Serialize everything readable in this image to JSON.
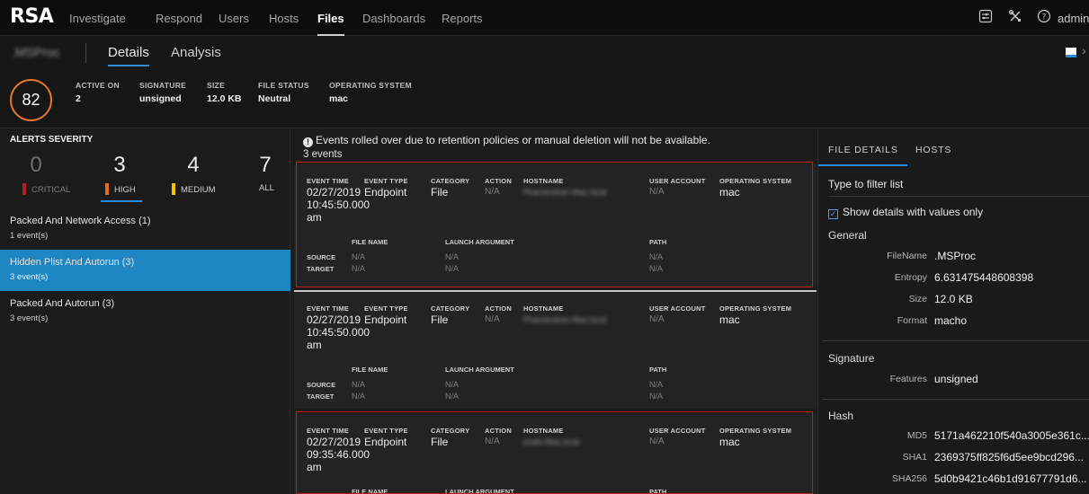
{
  "topnav": {
    "logo": "RSA",
    "items": [
      "Investigate",
      "Respond",
      "Users",
      "Hosts",
      "Files",
      "Dashboards",
      "Reports"
    ],
    "active": "Files",
    "icons": [
      "settings-sliders-icon",
      "tools-icon",
      "help-icon"
    ],
    "user": "admin"
  },
  "header": {
    "file_name": ".MSProc",
    "tabs": [
      "Details",
      "Analysis"
    ],
    "active_tab": "Details",
    "risk_score": "82",
    "stats": [
      {
        "label": "ACTIVE ON",
        "value": "2"
      },
      {
        "label": "SIGNATURE",
        "value": "unsigned"
      },
      {
        "label": "SIZE",
        "value": "12.0 KB"
      },
      {
        "label": "FILE STATUS",
        "value": "Neutral"
      },
      {
        "label": "OPERATING SYSTEM",
        "value": "mac"
      }
    ]
  },
  "alerts": {
    "title": "ALERTS SEVERITY",
    "severity": [
      {
        "count": "0",
        "label": "CRITICAL",
        "color": "#b7201f"
      },
      {
        "count": "3",
        "label": "HIGH",
        "color": "#e86a1d"
      },
      {
        "count": "4",
        "label": "MEDIUM",
        "color": "#f2c200"
      },
      {
        "count": "7",
        "label": "ALL",
        "color": ""
      }
    ],
    "items": [
      {
        "title": "Packed And Network Access (1)",
        "sub": "1 event(s)"
      },
      {
        "title": "Hidden Plist And Autorun (3)",
        "sub": "3 event(s)"
      },
      {
        "title": "Packed And Autorun (3)",
        "sub": "3 event(s)"
      }
    ]
  },
  "events": {
    "notice": "Events rolled over due to retention policies or manual deletion will not be available.",
    "count": "3 events",
    "headers": [
      "EVENT TIME",
      "EVENT TYPE",
      "CATEGORY",
      "ACTION",
      "HOSTNAME",
      "USER ACCOUNT",
      "OPERATING SYSTEM"
    ],
    "sub_headers": [
      "FILE NAME",
      "LAUNCH ARGUMENT",
      "PATH"
    ],
    "row_labels": [
      "SOURCE",
      "TARGET"
    ],
    "na": "N/A",
    "cards": [
      {
        "date": "02/27/2019",
        "time": "10:45:50.000",
        "ampm": "am",
        "type": "Endpoint",
        "category": "File",
        "action": "N/A",
        "hostname": "Pharsendran-Mac.local",
        "user": "N/A",
        "os": "mac"
      },
      {
        "date": "02/27/2019",
        "time": "10:45:50.000",
        "ampm": "am",
        "type": "Endpoint",
        "category": "File",
        "action": "N/A",
        "hostname": "Pharsendran-Mac.local",
        "user": "N/A",
        "os": "mac"
      },
      {
        "date": "02/27/2019",
        "time": "09:35:46.000",
        "ampm": "am",
        "type": "Endpoint",
        "category": "File",
        "action": "N/A",
        "hostname": "ecats-Mac.local",
        "user": "N/A",
        "os": "mac"
      }
    ]
  },
  "details": {
    "tabs": [
      "FILE DETAILS",
      "HOSTS"
    ],
    "filter_placeholder": "Type to filter list",
    "checkbox": "Show details with values only",
    "sections": {
      "general": "General",
      "signature": "Signature",
      "hash": "Hash"
    },
    "general": [
      {
        "k": "FileName",
        "v": ".MSProc"
      },
      {
        "k": "Entropy",
        "v": "6.631475448608398"
      },
      {
        "k": "Size",
        "v": "12.0 KB"
      },
      {
        "k": "Format",
        "v": "macho"
      }
    ],
    "signature": [
      {
        "k": "Features",
        "v": "unsigned"
      }
    ],
    "hash": [
      {
        "k": "MD5",
        "v": "5171a462210f540a3005e361c..."
      },
      {
        "k": "SHA1",
        "v": "2369375ff825f6d5ee9bcd296..."
      },
      {
        "k": "SHA256",
        "v": "5d0b9421c46b1d91677791d6..."
      }
    ]
  }
}
